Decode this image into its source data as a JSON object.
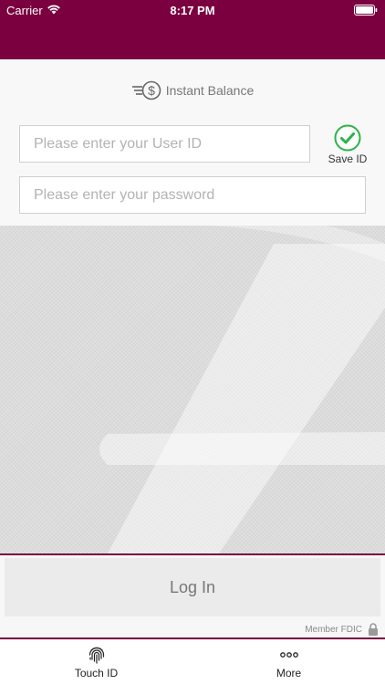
{
  "status_bar": {
    "carrier": "Carrier",
    "time": "8:17 PM"
  },
  "instant_balance": {
    "label": "Instant Balance",
    "icon": "instant-balance-dollar-icon"
  },
  "form": {
    "userid_placeholder": "Please enter your User ID",
    "password_placeholder": "Please enter your password",
    "save_id_label": "Save ID",
    "save_id_checked": true
  },
  "actions": {
    "login_label": "Log In"
  },
  "footer": {
    "member_fdic": "Member FDIC"
  },
  "tabs": [
    {
      "label": "Touch ID",
      "icon": "fingerprint-icon"
    },
    {
      "label": "More",
      "icon": "more-dots-icon"
    }
  ],
  "colors": {
    "brand": "#7a0040",
    "check": "#2db34a"
  }
}
